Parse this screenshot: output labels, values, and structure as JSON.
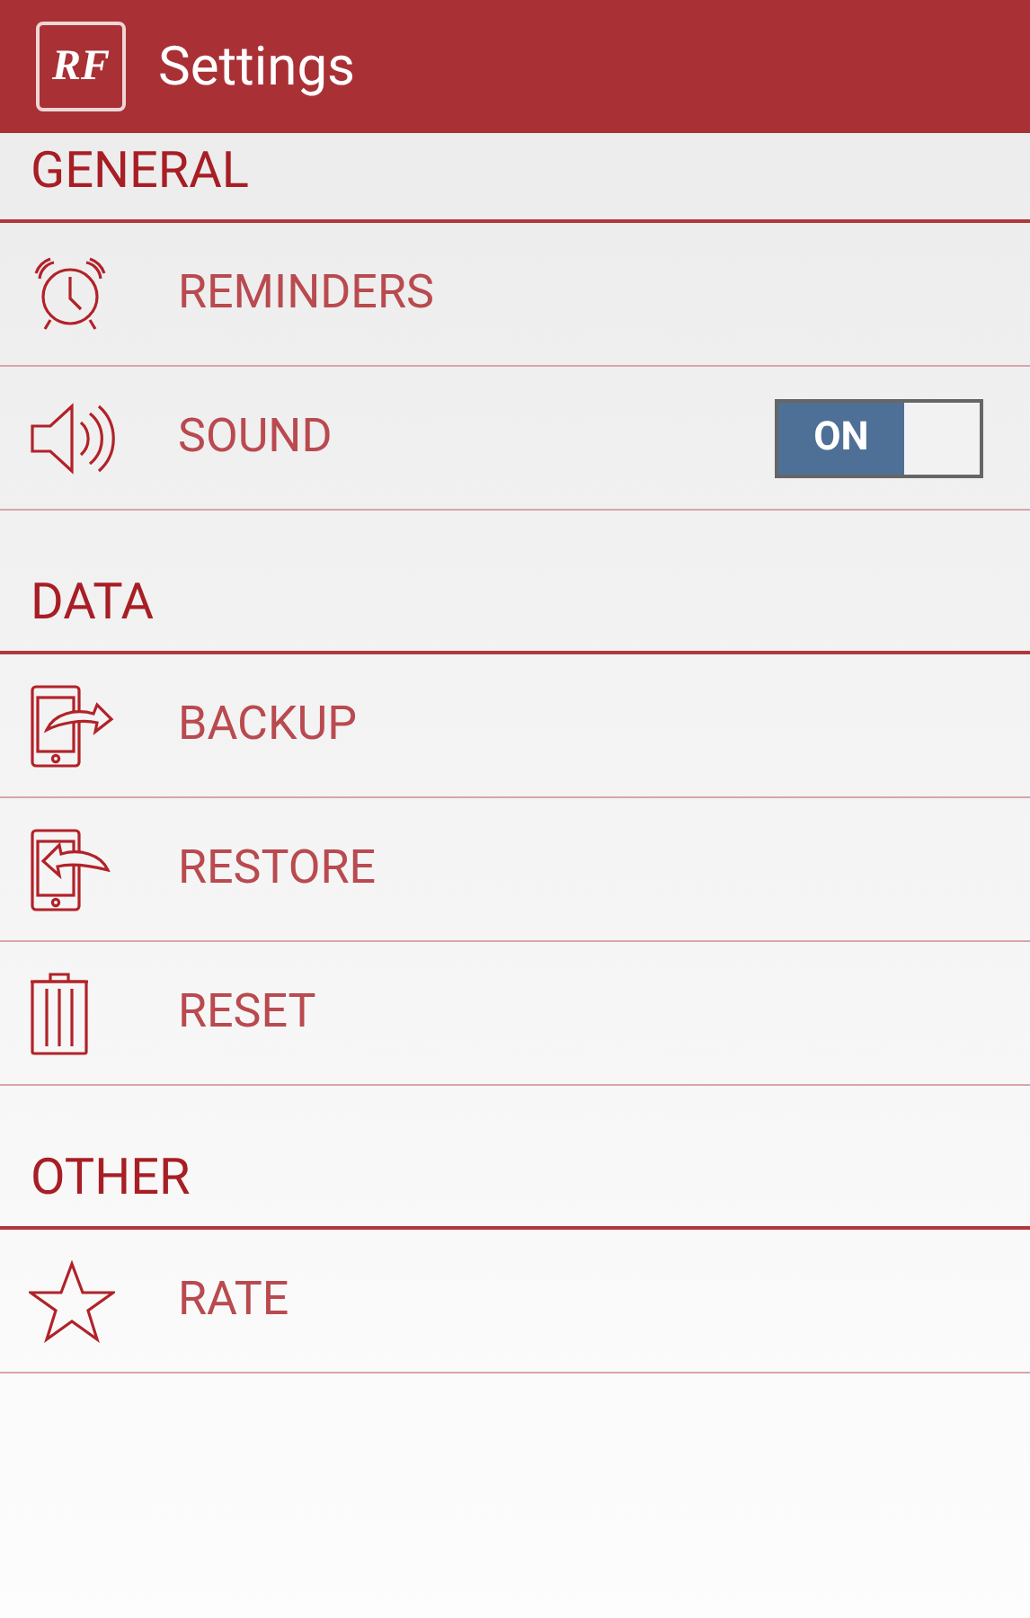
{
  "app_bar": {
    "logo": "RF",
    "title": "Settings"
  },
  "sections": [
    {
      "title": "GENERAL",
      "items": [
        {
          "label": "REMINDERS",
          "kind": "plain"
        },
        {
          "label": "SOUND",
          "kind": "toggle",
          "on": true,
          "toggle_label": "ON"
        }
      ]
    },
    {
      "title": "DATA",
      "items": [
        {
          "label": "BACKUP",
          "kind": "plain"
        },
        {
          "label": "RESTORE",
          "kind": "plain"
        },
        {
          "label": "RESET",
          "kind": "plain"
        }
      ]
    },
    {
      "title": "OTHER",
      "items": [
        {
          "label": "RATE",
          "kind": "plain"
        }
      ]
    }
  ]
}
